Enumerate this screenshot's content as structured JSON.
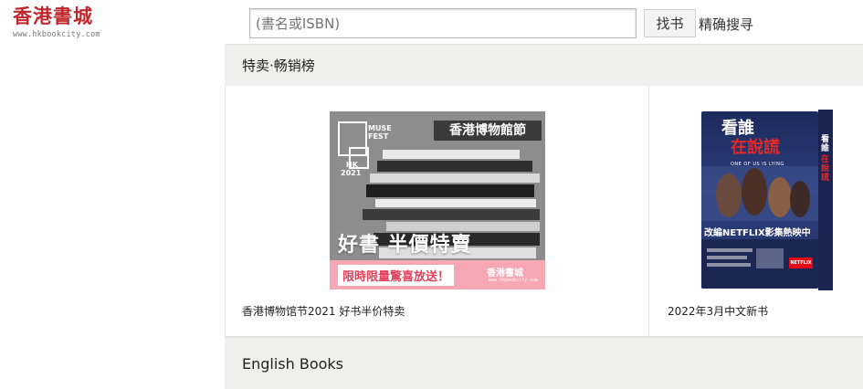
{
  "logo": {
    "title": "香港書城",
    "url": "www.hkbookcity.com"
  },
  "search": {
    "placeholder": "(書名或ISBN)",
    "button_label": "找书",
    "advanced_label": "精确搜寻"
  },
  "sections": [
    {
      "title": "特卖·畅销榜",
      "cards": [
        {
          "caption": "香港博物馆节2021 好书半价特卖",
          "image": {
            "fest_lines": [
              "MUSE",
              "FEST",
              "HK",
              "2021"
            ],
            "headline": "香港博物館節",
            "sale_text": "好書 半價特賣",
            "band_text": "限時限量驚喜放送！",
            "band_logo": "香港書城",
            "band_url": "www.hkbookcity.com"
          }
        },
        {
          "caption": "2022年3月中文新书",
          "image": {
            "title_line1": "看誰",
            "title_line2": "在說謊",
            "english_title": "ONE OF US IS LYING",
            "tagline": "改編NETFLIX影集熱映中",
            "badge": "NETFLIX"
          }
        }
      ]
    },
    {
      "title": "English Books"
    }
  ],
  "colors": {
    "brand_red": "#c0272d",
    "section_bg": "#efefed",
    "promo_pink": "#f7a7b3",
    "cover_navy": "#25336b"
  }
}
